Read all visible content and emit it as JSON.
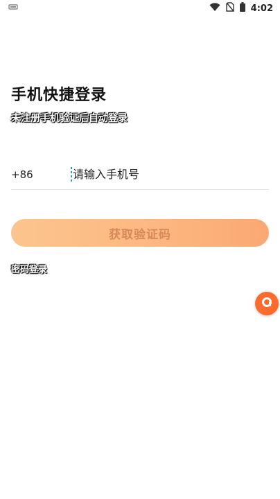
{
  "status_bar": {
    "time": "4:02",
    "icons": [
      "notification-icon",
      "wifi-icon",
      "no-sim-icon",
      "battery-icon"
    ]
  },
  "login": {
    "title": "手机快捷登录",
    "subtitle": "未注册手机验证后自动登录",
    "country_code": "+86",
    "phone_placeholder": "请输入手机号",
    "get_code_label": "获取验证码",
    "password_login_label": "密码登录"
  },
  "colors": {
    "button_gradient_start": "#fcc58e",
    "button_gradient_end": "#fba873",
    "button_text": "#d98958",
    "floating_ball": "#ff6b2e"
  },
  "floating_ball": {
    "icon": "assistant-icon"
  }
}
